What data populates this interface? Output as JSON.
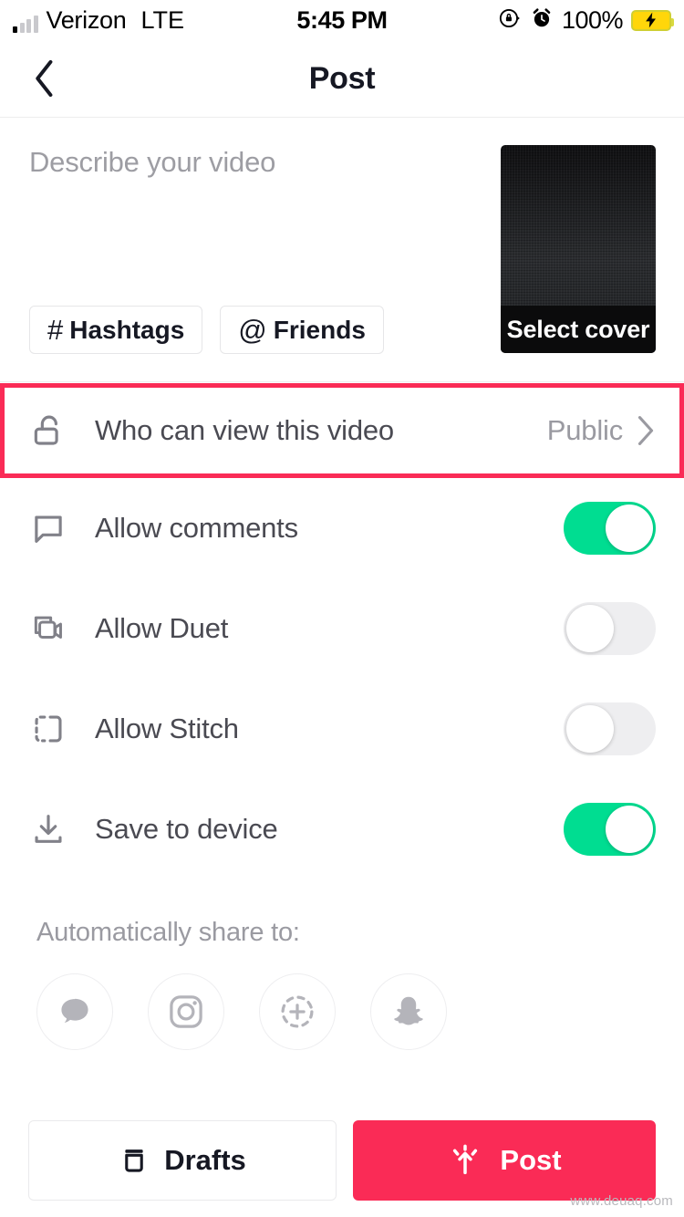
{
  "status_bar": {
    "carrier": "Verizon",
    "network": "LTE",
    "time": "5:45 PM",
    "battery_percent": "100%",
    "icons": [
      "signal-bars-icon",
      "rotation-lock-icon",
      "alarm-clock-icon",
      "battery-charging-icon"
    ]
  },
  "nav": {
    "title": "Post",
    "back_icon": "chevron-left-icon"
  },
  "describe": {
    "placeholder": "Describe your video",
    "value": "",
    "chips": [
      {
        "glyph": "#",
        "label": "Hashtags",
        "name": "hashtags-chip"
      },
      {
        "glyph": "@",
        "label": "Friends",
        "name": "friends-chip"
      }
    ],
    "cover": {
      "label": "Select cover"
    }
  },
  "settings": {
    "privacy": {
      "icon": "unlocked-padlock-icon",
      "label": "Who can view this video",
      "value": "Public",
      "chevron": "chevron-right-icon",
      "highlighted": true,
      "highlight_color": "#FA2B56"
    },
    "toggles": [
      {
        "icon": "comment-bubble-icon",
        "label": "Allow comments",
        "on": true,
        "name": "allow-comments"
      },
      {
        "icon": "duet-camera-icon",
        "label": "Allow Duet",
        "on": false,
        "name": "allow-duet"
      },
      {
        "icon": "stitch-bracket-icon",
        "label": "Allow Stitch",
        "on": false,
        "name": "allow-stitch"
      },
      {
        "icon": "download-icon",
        "label": "Save to device",
        "on": true,
        "name": "save-to-device"
      }
    ],
    "toggle_on_color": "#00DD91",
    "toggle_off_color": "#EEEEF0"
  },
  "share": {
    "title": "Automatically share to:",
    "targets": [
      {
        "name": "messages-share-icon",
        "icon": "message-bubble-icon"
      },
      {
        "name": "instagram-share-icon",
        "icon": "instagram-icon"
      },
      {
        "name": "instagram-story-share-icon",
        "icon": "instagram-story-plus-icon"
      },
      {
        "name": "snapchat-share-icon",
        "icon": "snapchat-ghost-icon"
      }
    ]
  },
  "bottom": {
    "drafts_label": "Drafts",
    "drafts_icon": "archive-box-icon",
    "post_label": "Post",
    "post_icon": "publish-arrow-icon",
    "post_color": "#FA2B56"
  },
  "watermark": "www.deuaq.com"
}
